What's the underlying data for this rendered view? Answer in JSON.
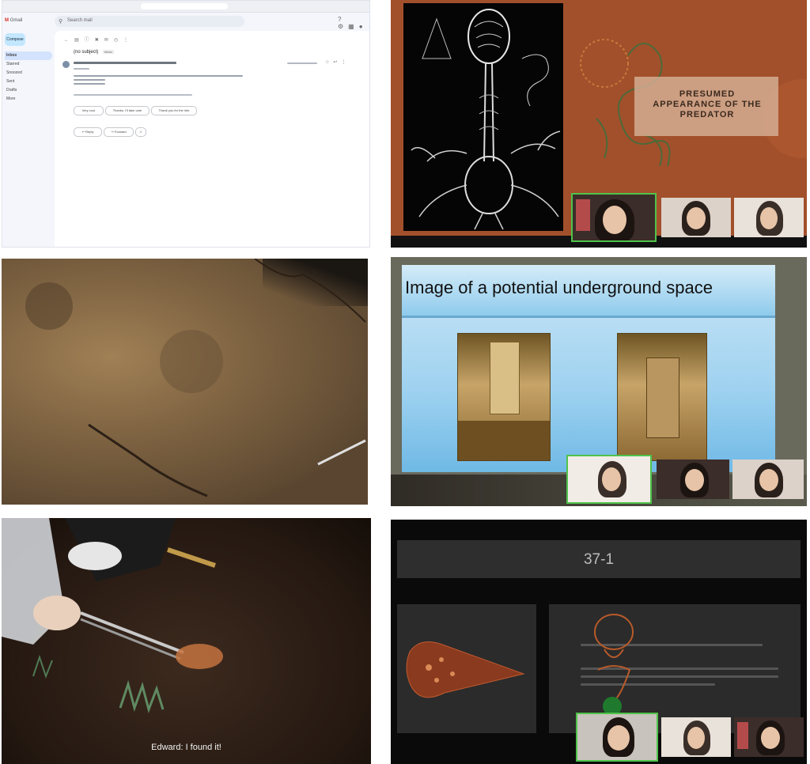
{
  "mail": {
    "brand_letter": "M",
    "brand_name": "Gmail",
    "search_placeholder": "Search mail",
    "compose_label": "Compose",
    "folders": [
      "Inbox",
      "Starred",
      "Snoozed",
      "Sent",
      "Drafts",
      "More"
    ],
    "subject": "(no subject)",
    "subject_tag": "Inbox",
    "chips": [
      "Very cool",
      "Thanks, I'll take care",
      "Thank you for the info"
    ],
    "actions": [
      "Reply",
      "Forward"
    ]
  },
  "predator_slide": {
    "title": "Presumed appearance of the predator"
  },
  "underground_slide": {
    "title": "Image of a potential underground space"
  },
  "photo_caption": {
    "text": "Edward: I found it!"
  },
  "dark_slide": {
    "heading": "37-1"
  },
  "icons": {
    "search": "search-icon",
    "gear": "gear-icon",
    "star": "star-icon"
  },
  "colors": {
    "active_tile_border": "#4fc34a"
  }
}
